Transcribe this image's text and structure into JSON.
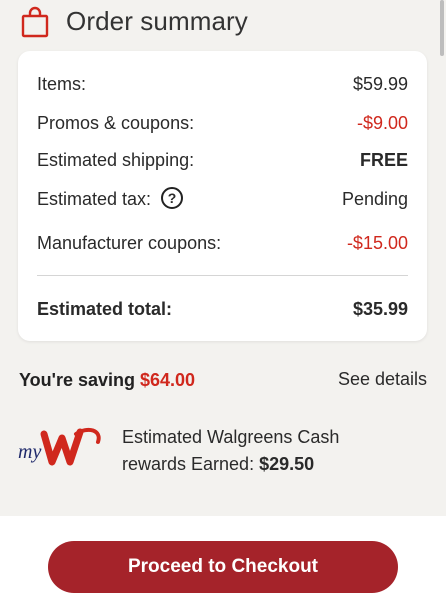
{
  "header": {
    "title": "Order summary",
    "icon": "shopping-bag-icon"
  },
  "summary": {
    "rows": [
      {
        "label": "Items:",
        "value": "$59.99"
      },
      {
        "label": "Promos & coupons:",
        "value": "-$9.00"
      },
      {
        "label": "Estimated shipping:",
        "value": "FREE"
      },
      {
        "label": "Estimated tax:",
        "value": "Pending",
        "help": "?"
      },
      {
        "label": "Manufacturer coupons:",
        "value": "-$15.00"
      }
    ],
    "total": {
      "label": "Estimated total:",
      "value": "$35.99"
    }
  },
  "savings": {
    "prefix": "You're saving ",
    "amount": "$64.00",
    "details_link": "See details"
  },
  "rewards": {
    "logo_text": "myW",
    "line1": "Estimated Walgreens Cash",
    "line2_prefix": "rewards Earned: ",
    "amount": "$29.50"
  },
  "checkout": {
    "label": "Proceed to Checkout"
  },
  "colors": {
    "brand_red": "#a5232a",
    "discount_red": "#d0281d",
    "logo_navy": "#1f2a6b"
  }
}
